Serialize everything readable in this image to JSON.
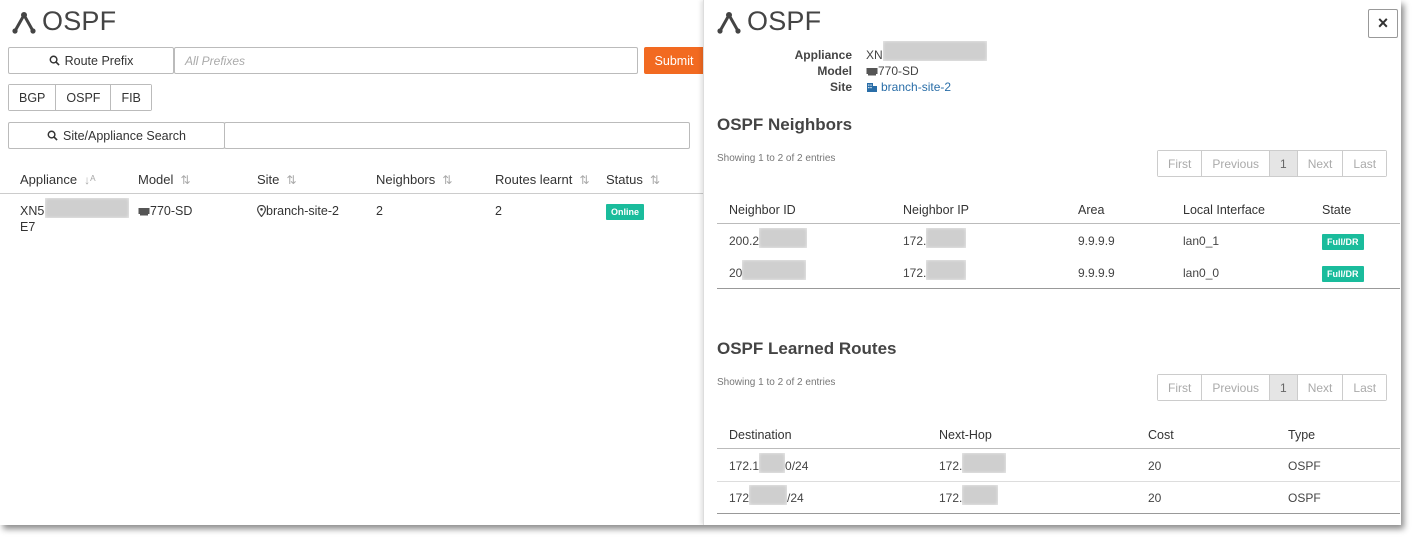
{
  "left": {
    "title": "OSPF",
    "route_prefix_btn": "Route Prefix",
    "prefix_placeholder": "All Prefixes",
    "submit": "Submit",
    "tabs": [
      "BGP",
      "OSPF",
      "FIB"
    ],
    "site_search_btn": "Site/Appliance Search",
    "columns": [
      "Appliance",
      "Model",
      "Site",
      "Neighbors",
      "Routes learnt",
      "Status"
    ],
    "row": {
      "appliance_line1": "XN5",
      "appliance_line2": "E7",
      "model": "770-SD",
      "site": "branch-site-2",
      "neighbors": "2",
      "routes": "2",
      "status": "Online"
    }
  },
  "right": {
    "title": "OSPF",
    "close": "×",
    "meta": {
      "appliance_label": "Appliance",
      "appliance_value": "XN",
      "model_label": "Model",
      "model_value": "770-SD",
      "site_label": "Site",
      "site_value": "branch-site-2"
    },
    "neighbors": {
      "title": "OSPF Neighbors",
      "showing": "Showing 1 to 2 of 2 entries",
      "pager": [
        "First",
        "Previous",
        "1",
        "Next",
        "Last"
      ],
      "columns": [
        "Neighbor ID",
        "Neighbor IP",
        "Area",
        "Local Interface",
        "State"
      ],
      "rows": [
        {
          "id": "200.2",
          "ip": "172.",
          "area": "9.9.9.9",
          "iface": "lan0_1",
          "state": "Full/DR"
        },
        {
          "id": "20",
          "ip": "172.",
          "area": "9.9.9.9",
          "iface": "lan0_0",
          "state": "Full/DR"
        }
      ]
    },
    "routes": {
      "title": "OSPF Learned Routes",
      "showing": "Showing 1 to 2 of 2 entries",
      "pager": [
        "First",
        "Previous",
        "1",
        "Next",
        "Last"
      ],
      "columns": [
        "Destination",
        "Next-Hop",
        "Cost",
        "Type"
      ],
      "rows": [
        {
          "dest_a": "172.1",
          "dest_b": "0/24",
          "hop": "172.",
          "cost": "20",
          "type": "OSPF"
        },
        {
          "dest_a": "172",
          "dest_b": "/24",
          "hop": "172.",
          "cost": "20",
          "type": "OSPF"
        }
      ]
    }
  },
  "colors": {
    "accent_orange": "#f26a21",
    "badge_green": "#1abc9c",
    "link_blue": "#2a6ea8"
  }
}
